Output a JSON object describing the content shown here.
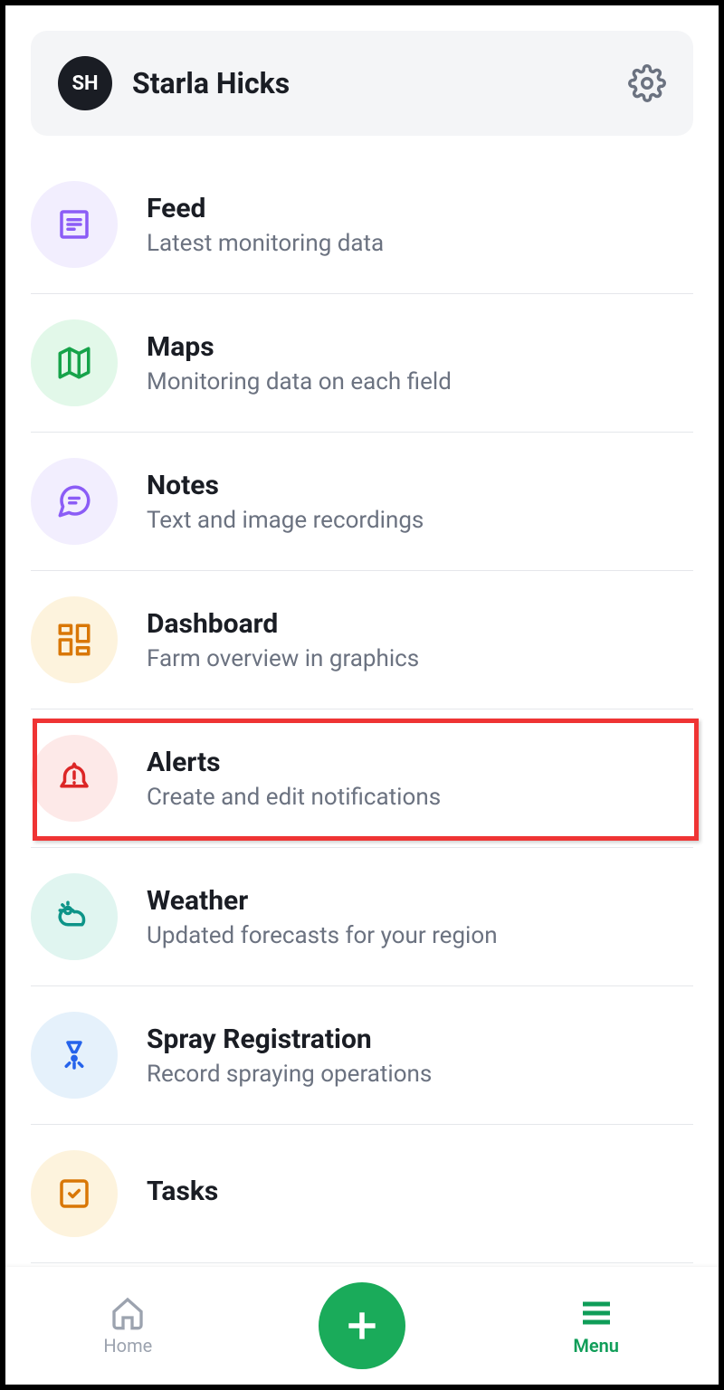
{
  "profile": {
    "initials": "SH",
    "name": "Starla Hicks"
  },
  "menu": [
    {
      "title": "Feed",
      "subtitle": "Latest monitoring data",
      "icon": "feed",
      "bg": "#f2eefe",
      "color": "#8b5cf6"
    },
    {
      "title": "Maps",
      "subtitle": "Monitoring data on each field",
      "icon": "map",
      "bg": "#e2f8e9",
      "color": "#16a34a"
    },
    {
      "title": "Notes",
      "subtitle": "Text and image recordings",
      "icon": "note",
      "bg": "#f2eefe",
      "color": "#8b5cf6"
    },
    {
      "title": "Dashboard",
      "subtitle": "Farm overview in graphics",
      "icon": "dashboard",
      "bg": "#fdf3dd",
      "color": "#d97706"
    },
    {
      "title": "Alerts",
      "subtitle": "Create and edit notifications",
      "icon": "alert",
      "bg": "#fde9e8",
      "color": "#dc2626"
    },
    {
      "title": "Weather",
      "subtitle": "Updated forecasts for your region",
      "icon": "weather",
      "bg": "#e0f5f0",
      "color": "#0d9488"
    },
    {
      "title": "Spray Registration",
      "subtitle": "Record spraying operations",
      "icon": "spray",
      "bg": "#e5f1fb",
      "color": "#2563eb"
    },
    {
      "title": "Tasks",
      "subtitle": "",
      "icon": "tasks",
      "bg": "#fdf3dd",
      "color": "#d97706"
    }
  ],
  "highlighted_index": 4,
  "bottom_nav": {
    "home": "Home",
    "menu": "Menu"
  }
}
